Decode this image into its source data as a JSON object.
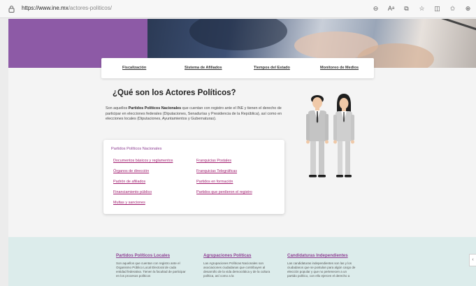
{
  "browser": {
    "url_host": "https://www.ine.mx",
    "url_path": "/actores-politicos/",
    "icons": [
      "lock-icon",
      "zoom-icon",
      "read-aloud-icon",
      "tab-icon",
      "favorite-icon",
      "split-screen-icon",
      "favorites-icon",
      "collections-icon"
    ]
  },
  "subnav": {
    "items": [
      "Fiscalización",
      "Sistema de Afiliados",
      "Tiempos del Estado",
      "Monitoreo de Medios"
    ]
  },
  "main": {
    "title": "¿Qué son los Actores Políticos?",
    "intro_pre": "Son aquellos ",
    "intro_bold": "Partidos Políticos Nacionales",
    "intro_post": " que cuentan con registro ante el INE y tienen el derecho de participar en elecciones federales (Diputaciones, Senadurías y Presidencia de la República), así como en elecciones locales (Diputaciones, Ayuntamientos y Gubernaturas)."
  },
  "card": {
    "title": "Partidos Políticos Nacionales",
    "left_links": [
      "Documentos básicos y reglamentos",
      "Órganos de dirección",
      "Padrón de afiliados",
      "Financiamiento público",
      "Multas y sanciones"
    ],
    "right_links": [
      "Franquicias Postales",
      "Franquicias Telegráficas",
      "Partidos en formación",
      "Partidos que perdieron el registro"
    ]
  },
  "footer": {
    "columns": [
      {
        "title": "Partidos Políticos Locales",
        "text": "Son aquellos que cuentan con registro ante el Organismo Público Local Electoral de cada entidad federativa. Tienen la facultad de participar en los procesos políticos"
      },
      {
        "title": "Agrupaciones Políticas",
        "text": "Las Agrupaciones Políticas Nacionales son asociaciones ciudadanas que contribuyen al desarrollo de la vida democrática y de la cultura política, así como a la"
      },
      {
        "title": "Candidaturas Independientes",
        "text": "Las candidaturas independientes son las y los ciudadanos que se postulan para algún cargo de elección popular y que no pertenecen a un partido político, con ello ejercen el derecho a"
      }
    ]
  },
  "colors": {
    "brand_purple": "#8d5aa6",
    "link_magenta": "#a01c6e",
    "footer_bg": "#dceceb"
  }
}
